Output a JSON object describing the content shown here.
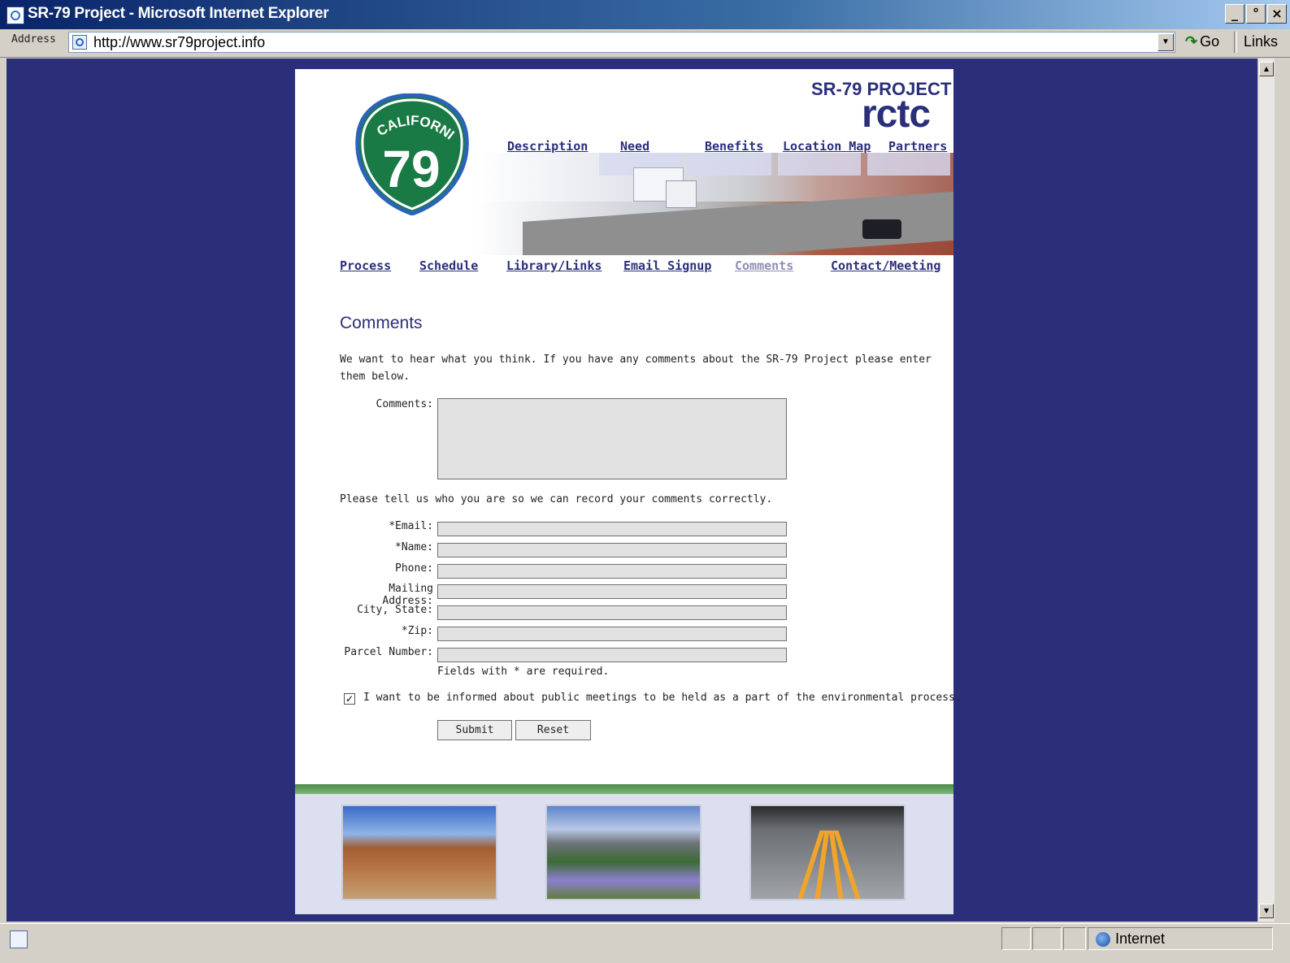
{
  "window": {
    "title": "SR-79 Project - Microsoft Internet Explorer",
    "buttons": [
      "_",
      "°",
      "×"
    ]
  },
  "addressbar": {
    "label": "Address",
    "url": "http://www.sr79project.info",
    "go_label": "Go",
    "links_label": "Links"
  },
  "brand": {
    "sign_state": "CALIFORNIA",
    "sign_number": "79",
    "project": "SR-79 PROJECT",
    "agency": "rctc"
  },
  "topnav": [
    "Description",
    "Need",
    "Benefits",
    "Location Map",
    "Partners"
  ],
  "secnav": [
    "Process",
    "Schedule",
    "Library/Links",
    "Email Signup",
    "Comments",
    "Contact/Meeting"
  ],
  "form": {
    "heading": "Comments",
    "intro": "We want to hear what you think. If you have any comments about the SR-79 Project please enter them below.",
    "comments_label": "Comments:",
    "comments_value": "",
    "ask": "Please tell us who you are so we can record your comments correctly.",
    "fields": [
      {
        "label": "*Email:",
        "value": ""
      },
      {
        "label": "*Name:",
        "value": ""
      },
      {
        "label": "Phone:",
        "value": ""
      },
      {
        "label": "Mailing Address:",
        "value": ""
      },
      {
        "label": "City, State:",
        "value": ""
      },
      {
        "label": "*Zip:",
        "value": ""
      },
      {
        "label": "Parcel Number:",
        "value": ""
      }
    ],
    "required_note": "Fields with * are required.",
    "checkbox_checked": true,
    "checkbox_label": "I want to be informed about public meetings to be held as a part of the environmental process.",
    "submit_label": "Submit",
    "reset_label": "Reset"
  },
  "statusbar": {
    "zone": "Internet"
  },
  "colors": {
    "page_bg": "#2b2f7a",
    "link": "#2b2f7a",
    "visited_link": "#8e8eb5",
    "footer": "#dcdff0",
    "green_bar": "#4f8a4c"
  }
}
